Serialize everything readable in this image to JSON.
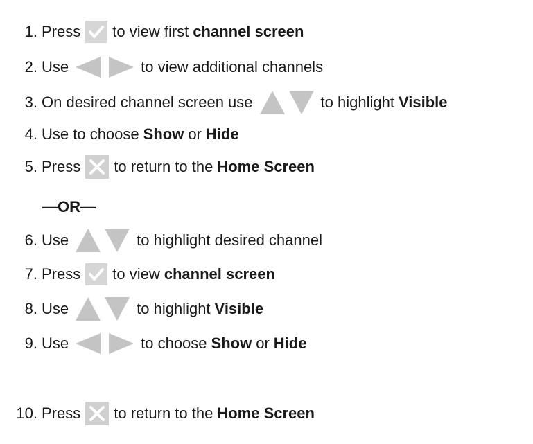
{
  "steps": [
    {
      "n": "1.",
      "pre": "Press",
      "icon": "check-button-icon",
      "post": "to view first",
      "bold": "channel screen",
      "tail": ""
    },
    {
      "n": "2.",
      "pre": "Use",
      "icon": "left-right-arrows-icon",
      "post": "to view additional channels",
      "bold": "",
      "tail": ""
    },
    {
      "n": "3.",
      "pre": "On desired channel screen use",
      "icon": "up-down-arrows-icon",
      "post": "to highlight",
      "bold": "Visible",
      "tail": ""
    },
    {
      "n": "4.",
      "pre": "Use to choose",
      "icon": "",
      "post": "",
      "bold": "Show",
      "mid": "or",
      "bold2": "Hide"
    },
    {
      "n": "5.",
      "pre": "Press",
      "icon": "close-button-icon",
      "post": "to return to the",
      "bold": "Home Screen",
      "tail": ""
    },
    {
      "n": "6.",
      "pre": "Use",
      "icon": "up-down-arrows-icon",
      "post": "to highlight desired channel",
      "bold": "",
      "tail": ""
    },
    {
      "n": "7.",
      "pre": "Press",
      "icon": "check-button-icon",
      "post": "to view",
      "bold": "channel screen",
      "tail": ""
    },
    {
      "n": "8.",
      "pre": "Use",
      "icon": "up-down-arrows-icon",
      "post": "to highlight",
      "bold": "Visible",
      "tail": ""
    },
    {
      "n": "9.",
      "pre": "Use",
      "icon": "left-right-arrows-icon",
      "post": "to choose",
      "bold": "Show",
      "mid": "or",
      "bold2": "Hide"
    },
    {
      "n": "10.",
      "pre": "Press",
      "icon": "close-button-icon",
      "post": "to return to the",
      "bold": "Home Screen",
      "tail": ""
    }
  ],
  "separator": "—OR—",
  "colors": {
    "icon_gray": "#b8b8b8",
    "icon_light": "#d9d9d9",
    "check_stroke": "#ffffff",
    "text": "#1a1a1a"
  }
}
